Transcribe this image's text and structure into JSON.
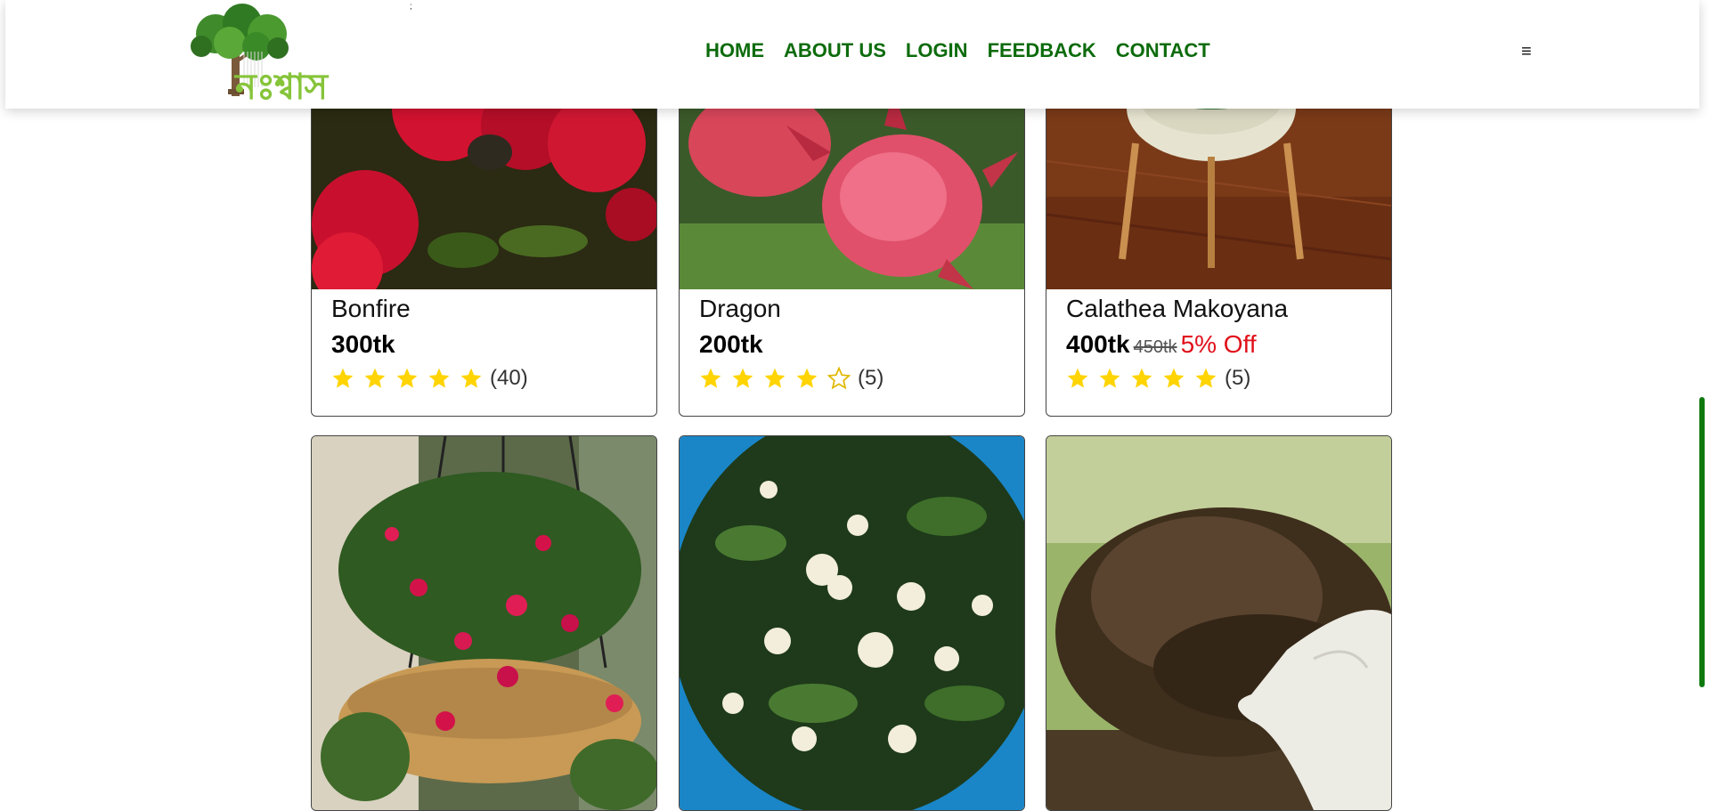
{
  "nav": {
    "logo_text": "নঃশ্বাস",
    "stray_mark": ";",
    "links": [
      "HOME",
      "ABOUT US",
      "LOGIN",
      "FEEDBACK",
      "CONTACT"
    ],
    "menu_icon": "≡"
  },
  "products": [
    {
      "name": "Bonfire",
      "price": "300tk",
      "old_price": "",
      "discount": "",
      "rating": 5,
      "count": "(40)"
    },
    {
      "name": "Dragon",
      "price": "200tk",
      "old_price": "",
      "discount": "",
      "rating": 4,
      "count": "(5)"
    },
    {
      "name": "Calathea Makoyana",
      "price": "400tk",
      "old_price": "450tk",
      "discount": "5% Off",
      "rating": 5,
      "count": "(5)"
    }
  ],
  "colors": {
    "nav_link": "#0c6b0c",
    "star": "#ffd400",
    "discount": "#e0101a",
    "scroll_indicator": "#0e7a0e"
  },
  "icons": {
    "menu": "hamburger-menu-icon",
    "star": "star-icon"
  }
}
